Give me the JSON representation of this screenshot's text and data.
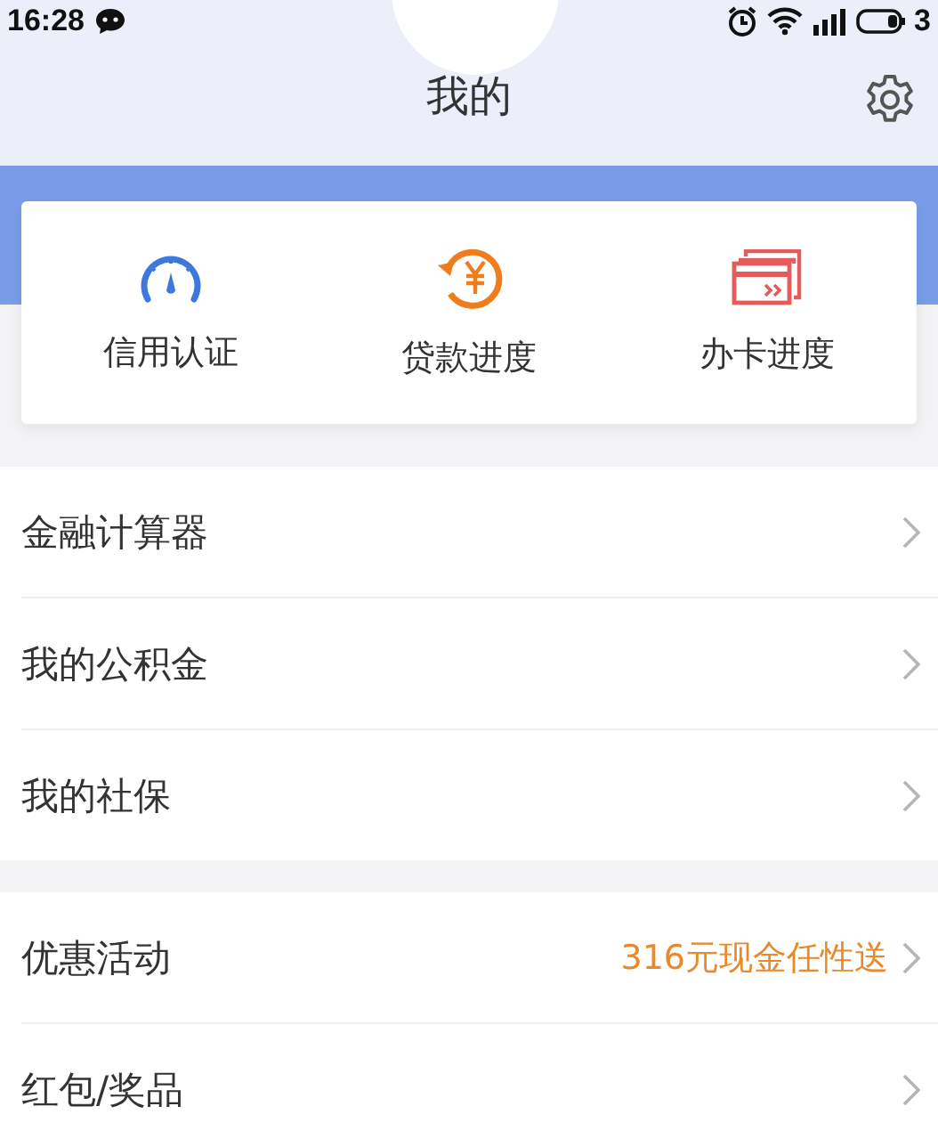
{
  "status_bar": {
    "time": "16:28",
    "battery": "3"
  },
  "header": {
    "title": "我的"
  },
  "shortcuts": [
    {
      "label": "信用认证",
      "kind": "gauge"
    },
    {
      "label": "贷款进度",
      "kind": "refund"
    },
    {
      "label": "办卡进度",
      "kind": "cards"
    }
  ],
  "menu_groups": [
    [
      {
        "label": "金融计算器"
      },
      {
        "label": "我的公积金"
      },
      {
        "label": "我的社保"
      }
    ],
    [
      {
        "label": "优惠活动",
        "note": "316元现金任性送"
      },
      {
        "label": "红包/奖品"
      }
    ]
  ]
}
